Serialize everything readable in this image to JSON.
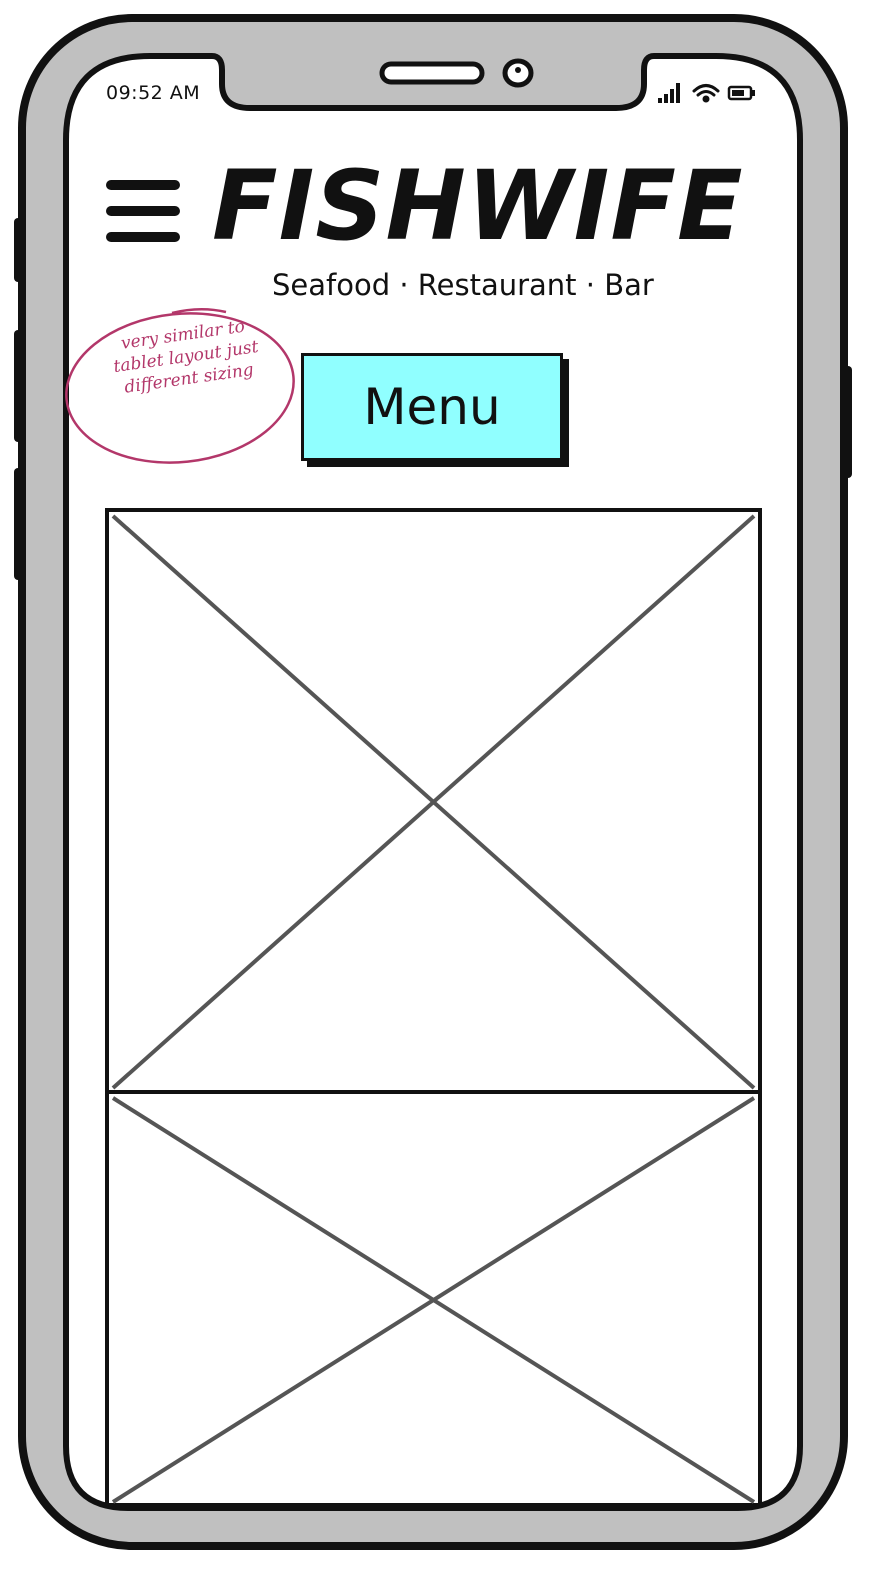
{
  "status_bar": {
    "time": "09:52 AM"
  },
  "header": {
    "brand": "FISHWIFE",
    "tagline": "Seafood · Restaurant · Bar"
  },
  "main": {
    "menu_button_label": "Menu"
  },
  "annotation": {
    "note": "very similar to tablet layout just different sizing",
    "color": "#b3376a"
  },
  "colors": {
    "menu_button_bg": "#90ffff",
    "device_frame": "#c0c0c0"
  },
  "icons": [
    "hamburger-menu-icon",
    "signal-icon",
    "wifi-icon",
    "battery-icon",
    "camera-icon"
  ]
}
